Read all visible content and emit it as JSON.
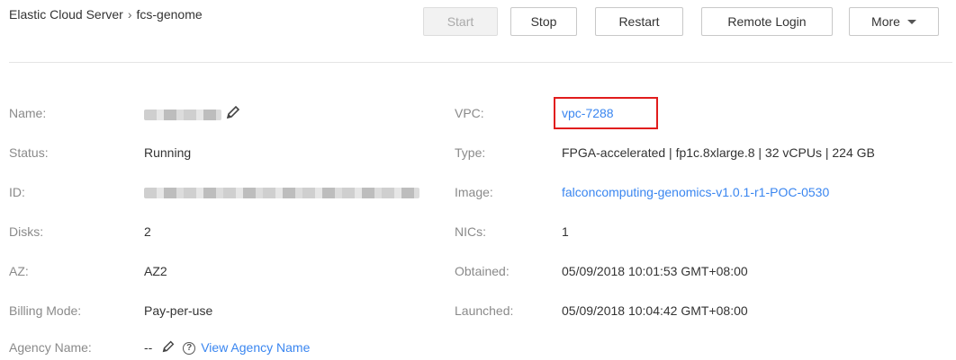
{
  "breadcrumb": {
    "root": "Elastic Cloud Server",
    "separator": "›",
    "current": "fcs-genome"
  },
  "toolbar": {
    "start": "Start",
    "stop": "Stop",
    "restart": "Restart",
    "remote_login": "Remote Login",
    "more": "More"
  },
  "details": {
    "name_label": "Name:",
    "status_label": "Status:",
    "status_value": "Running",
    "id_label": "ID:",
    "disks_label": "Disks:",
    "disks_value": "2",
    "az_label": "AZ:",
    "az_value": "AZ2",
    "billing_label": "Billing Mode:",
    "billing_value": "Pay-per-use",
    "agency_label": "Agency Name:",
    "agency_value": "--",
    "agency_link": "View Agency Name",
    "vpc_label": "VPC:",
    "vpc_value": "vpc-7288",
    "type_label": "Type:",
    "type_value": "FPGA-accelerated | fp1c.8xlarge.8 | 32 vCPUs | 224 GB",
    "image_label": "Image:",
    "image_value": "falconcomputing-genomics-v1.0.1-r1-POC-0530",
    "nics_label": "NICs:",
    "nics_value": "1",
    "obtained_label": "Obtained:",
    "obtained_value": "05/09/2018 10:01:53 GMT+08:00",
    "launched_label": "Launched:",
    "launched_value": "05/09/2018 10:04:42 GMT+08:00"
  },
  "colors": {
    "link": "#3a86f0",
    "highlight_box": "#e11d1d",
    "label": "#8a8a8a"
  },
  "icons": {
    "edit": "pencil-icon",
    "help": "help-icon",
    "dropdown": "chevron-down-icon"
  }
}
